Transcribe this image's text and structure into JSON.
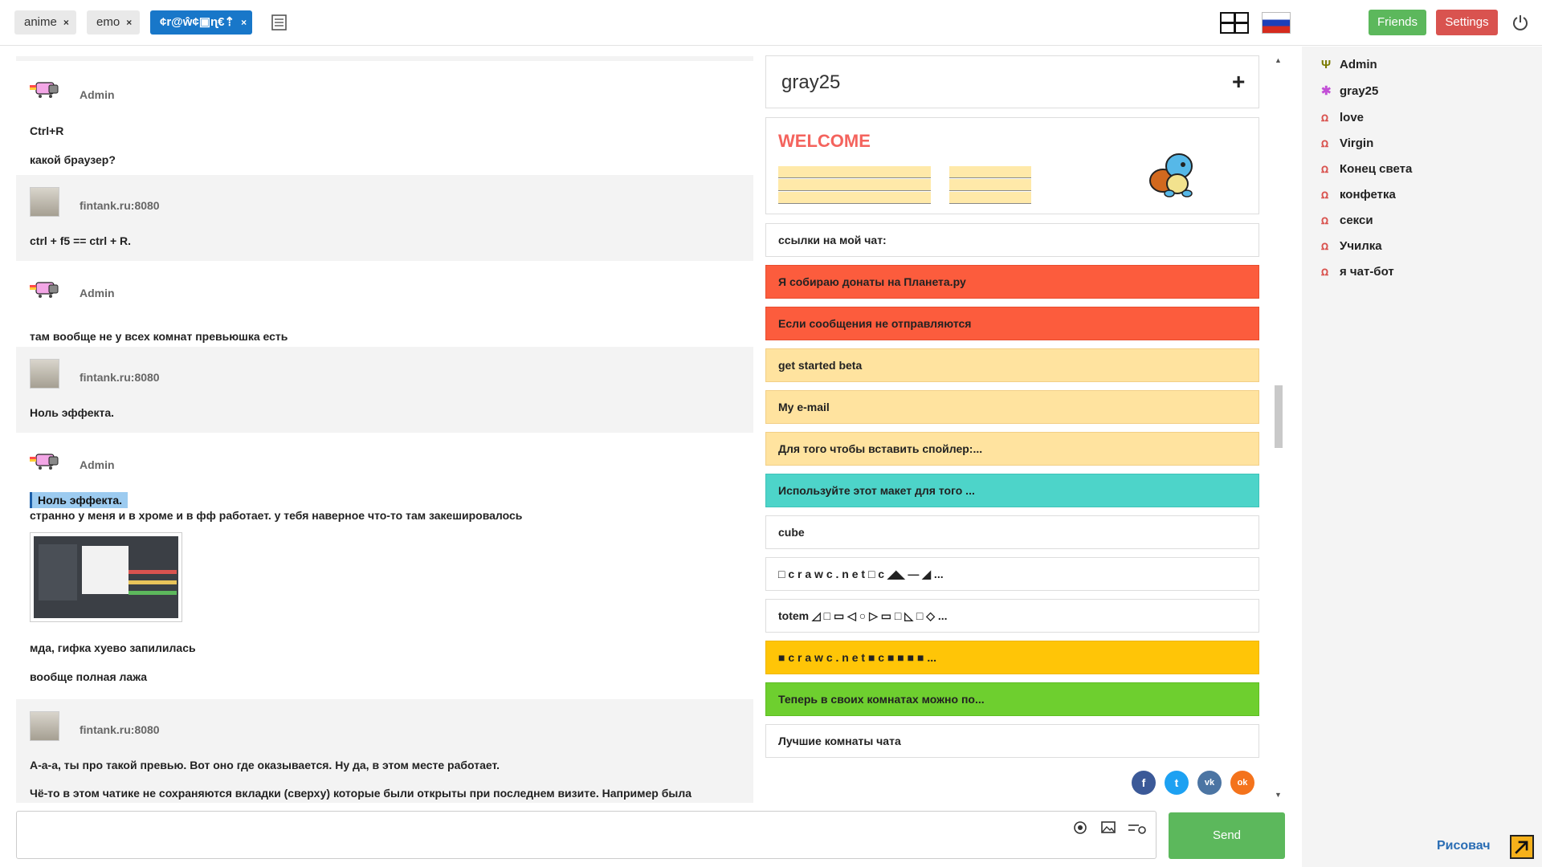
{
  "tabs": [
    {
      "label": "anime",
      "close": "×"
    },
    {
      "label": "emo",
      "close": "×"
    },
    {
      "label": "¢r@ŵ¢▣ɳ€⇡",
      "close": "×"
    }
  ],
  "header": {
    "friends_label": "Friends",
    "settings_label": "Settings"
  },
  "messages": [
    {
      "author": "Admin",
      "avatar": "nyan-cat-icon",
      "lines": [
        "Ctrl+R",
        "какой браузер?"
      ]
    },
    {
      "author": "fintank.ru:8080",
      "avatar": "photo-avatar",
      "lines": [
        "ctrl + f5 == ctrl + R."
      ]
    },
    {
      "author": "Admin",
      "avatar": "nyan-cat-icon",
      "lines": [
        "там вообще не у всех комнат превьюшка есть"
      ]
    },
    {
      "author": "fintank.ru:8080",
      "avatar": "photo-avatar",
      "lines": [
        "Ноль эффекта."
      ]
    },
    {
      "author": "Admin",
      "avatar": "nyan-cat-icon",
      "quote": "Ноль эффекта.",
      "lines": [
        "странно у меня и в хроме и в фф работает. у тебя наверное что-то там закешировалось"
      ],
      "after_image": [
        "мда, гифка хуево запилилась",
        "вообще полная лажа"
      ]
    },
    {
      "author": "fintank.ru:8080",
      "avatar": "photo-avatar",
      "lines": [
        "А-а-а, ты про такой превью. Вот оно где оказывается. Ну да, в этом месте работает.",
        "Чё-то в этом чатике не сохраняются вкладки (сверху) которые были открыты при последнем визите. Например была"
      ]
    }
  ],
  "input": {
    "placeholder": "",
    "send_label": "Send"
  },
  "room": {
    "name": "gray25",
    "add_symbol": "+"
  },
  "welcome": {
    "title": "WELCOME"
  },
  "links": [
    {
      "label": "ссылки на мой чат:",
      "color": "#ffffff"
    },
    {
      "label": "Я собираю донаты на Планета.ру",
      "color": "#fc5c3d"
    },
    {
      "label": "Если сообщения не отправляются",
      "color": "#fc5c3d"
    },
    {
      "label": "get started beta",
      "color": "#ffe39f"
    },
    {
      "label": "My e-mail",
      "color": "#ffe39f"
    },
    {
      "label": "Для того чтобы вставить спойлер:...",
      "color": "#ffe39f"
    },
    {
      "label": "Используйте этот макет для того ...",
      "color": "#4dd4c9"
    },
    {
      "label": "cube",
      "color": "#ffffff"
    },
    {
      "label": "□ c r a w c . n e t □ c ◢◣ ― ◢ ...",
      "color": "#ffffff"
    },
    {
      "label": "totem ◿ □ ▭ ◁ ○ ▷ ▭ □ ◺ □ ◇ ...",
      "color": "#ffffff"
    },
    {
      "label": "■ c r a w c . n e t ■ c ■ ■ ■ ■ ...",
      "color": "#ffc507"
    },
    {
      "label": "Теперь в своих комнатах можно по...",
      "color": "#6ecf2f"
    },
    {
      "label": "Лучшие комнаты чата",
      "color": "#ffffff"
    }
  ],
  "social": [
    {
      "icon": "facebook-icon",
      "glyph": "f",
      "color": "#3b5998"
    },
    {
      "icon": "twitter-icon",
      "glyph": "t",
      "color": "#1da1f2"
    },
    {
      "icon": "vk-icon",
      "glyph": "vk",
      "color": "#4c75a3"
    },
    {
      "icon": "odnoklassniki-icon",
      "glyph": "ok",
      "color": "#f4731c"
    }
  ],
  "users": [
    {
      "name": "Admin",
      "icon": "Ψ",
      "icon_color": "#7a7a00"
    },
    {
      "name": "gray25",
      "icon": "✱",
      "icon_color": "#c24fd6"
    },
    {
      "name": "love",
      "icon": "ꭥ",
      "icon_color": "#d9534f"
    },
    {
      "name": "Virgin",
      "icon": "ꭥ",
      "icon_color": "#d9534f"
    },
    {
      "name": "Конец света",
      "icon": "ꭥ",
      "icon_color": "#d9534f"
    },
    {
      "name": "конфетка",
      "icon": "ꭥ",
      "icon_color": "#d9534f"
    },
    {
      "name": "секси",
      "icon": "ꭥ",
      "icon_color": "#d9534f"
    },
    {
      "name": "Училка",
      "icon": "ꭥ",
      "icon_color": "#d9534f"
    },
    {
      "name": "я чат-бот",
      "icon": "ꭥ",
      "icon_color": "#d9534f"
    }
  ],
  "draw_link": "Рисовач"
}
